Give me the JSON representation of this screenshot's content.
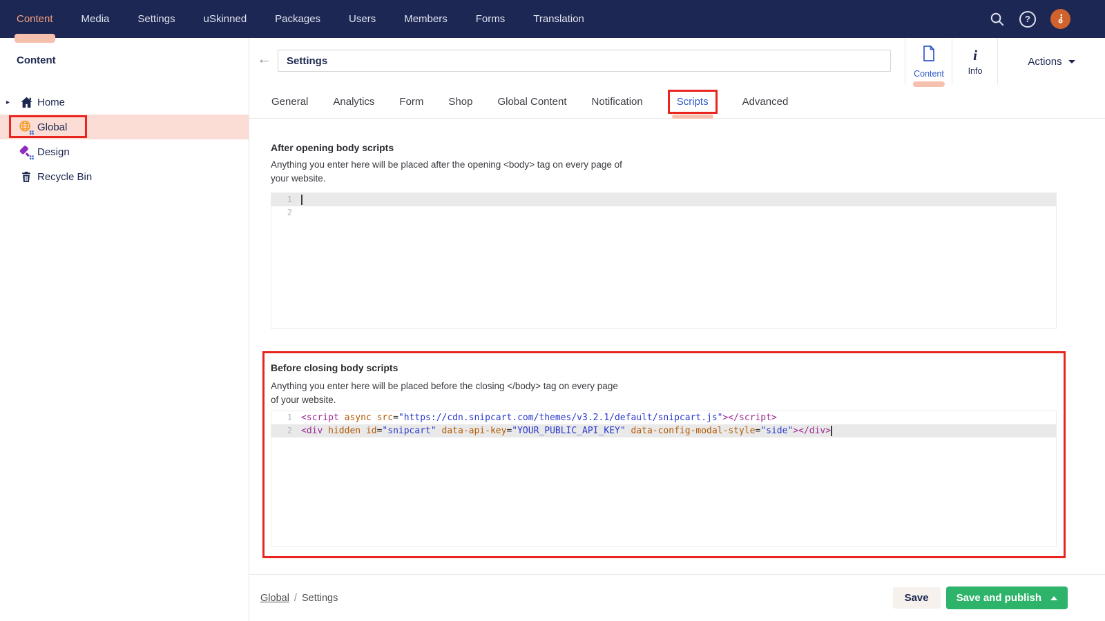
{
  "colors": {
    "navbar_bg": "#1d2753",
    "accent_salmon": "#f79e80",
    "pill_pink": "#f6c0ae",
    "row_highlight_pink": "#fbddd6",
    "annotation_red": "#e8251f",
    "accent_blue": "#3059c8",
    "navy_text": "#1b264f",
    "green_button": "#2eb36b",
    "code_tag": "#9c2b93",
    "code_attr": "#b35900",
    "code_string": "#2838cc"
  },
  "topnav": {
    "items": [
      {
        "label": "Content",
        "active": true
      },
      {
        "label": "Media"
      },
      {
        "label": "Settings"
      },
      {
        "label": "uSkinned"
      },
      {
        "label": "Packages"
      },
      {
        "label": "Users"
      },
      {
        "label": "Members"
      },
      {
        "label": "Forms"
      },
      {
        "label": "Translation"
      }
    ],
    "help_glyph": "?"
  },
  "sidebar": {
    "title": "Content",
    "items": [
      {
        "label": "Home",
        "icon": "home-icon",
        "caret": true
      },
      {
        "label": "Global",
        "icon": "globe-icon",
        "selected": true,
        "annotated": true
      },
      {
        "label": "Design",
        "icon": "paint-icon"
      },
      {
        "label": "Recycle Bin",
        "icon": "trash-icon"
      }
    ]
  },
  "header": {
    "back_arrow": "←",
    "title_value": "Settings",
    "content_tab_label": "Content",
    "info_tab_label": "Info",
    "info_icon_glyph": "i",
    "actions_label": "Actions"
  },
  "tabs": {
    "items": [
      {
        "label": "General"
      },
      {
        "label": "Analytics"
      },
      {
        "label": "Form"
      },
      {
        "label": "Shop"
      },
      {
        "label": "Global Content"
      },
      {
        "label": "Notification"
      },
      {
        "label": "Scripts",
        "active": true,
        "annotated": true
      },
      {
        "label": "Advanced"
      }
    ]
  },
  "sections": [
    {
      "heading": "After opening body scripts",
      "description_line1": "Anything you enter here will be placed after the opening <body> tag on every page of",
      "description_line2": "your website.",
      "lines": [
        {
          "number": "1",
          "active": true,
          "cursor": "start",
          "tokens": []
        },
        {
          "number": "2",
          "tokens": []
        }
      ]
    },
    {
      "heading": "Before closing body scripts",
      "description_line1": "Anything you enter here will be placed before the closing </body> tag on every page",
      "description_line2": "of your website.",
      "lines": [
        {
          "number": "1",
          "tokens": [
            {
              "t": "<script",
              "c": "tag"
            },
            {
              "t": " ",
              "c": "pl"
            },
            {
              "t": "async",
              "c": "attr"
            },
            {
              "t": " ",
              "c": "pl"
            },
            {
              "t": "src",
              "c": "attr"
            },
            {
              "t": "=",
              "c": "pl"
            },
            {
              "t": "\"https://cdn.snipcart.com/themes/v3.2.1/default/snipcart.js\"",
              "c": "str"
            },
            {
              "t": "></script>",
              "c": "tag"
            }
          ]
        },
        {
          "number": "2",
          "active": true,
          "cursor": "end",
          "tokens": [
            {
              "t": "<div",
              "c": "tag"
            },
            {
              "t": " ",
              "c": "pl"
            },
            {
              "t": "hidden",
              "c": "attr"
            },
            {
              "t": " ",
              "c": "pl"
            },
            {
              "t": "id",
              "c": "attr"
            },
            {
              "t": "=",
              "c": "pl"
            },
            {
              "t": "\"snipcart\"",
              "c": "str"
            },
            {
              "t": " ",
              "c": "pl"
            },
            {
              "t": "data-api-key",
              "c": "attr"
            },
            {
              "t": "=",
              "c": "pl"
            },
            {
              "t": "\"YOUR_PUBLIC_API_KEY\"",
              "c": "str"
            },
            {
              "t": " ",
              "c": "pl"
            },
            {
              "t": "data-config-modal-style",
              "c": "attr"
            },
            {
              "t": "=",
              "c": "pl"
            },
            {
              "t": "\"side\"",
              "c": "str"
            },
            {
              "t": "></div>",
              "c": "tag"
            }
          ]
        }
      ]
    }
  ],
  "footer": {
    "breadcrumb": {
      "link": "Global",
      "separator": "/",
      "current": "Settings"
    },
    "save_label": "Save",
    "save_publish_label": "Save and publish"
  }
}
